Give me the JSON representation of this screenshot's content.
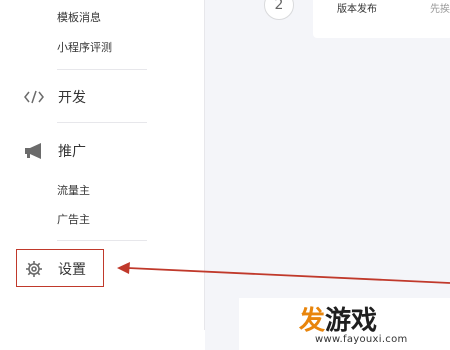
{
  "sidebar": {
    "groups": [
      {
        "sub_items": [
          {
            "label": "模板消息"
          },
          {
            "label": "小程序评测"
          }
        ]
      },
      {
        "label": "开发",
        "icon": "code-icon"
      },
      {
        "label": "推广",
        "icon": "megaphone-icon",
        "sub_items": [
          {
            "label": "流量主"
          },
          {
            "label": "广告主"
          }
        ]
      },
      {
        "label": "设置",
        "icon": "gear-icon",
        "highlighted": true
      }
    ]
  },
  "main": {
    "step": {
      "number": "2",
      "title": "版本发布",
      "next_hint": "先挨"
    }
  },
  "annotation": {
    "arrow_color": "#c0392b"
  },
  "watermark": {
    "logo_part1": "发",
    "logo_part2": "游戏",
    "url": "www.fayouxi.com"
  },
  "colors": {
    "main_bg": "#f4f5f9",
    "divider": "#e7e7eb",
    "logo_orange": "#e8850c"
  }
}
